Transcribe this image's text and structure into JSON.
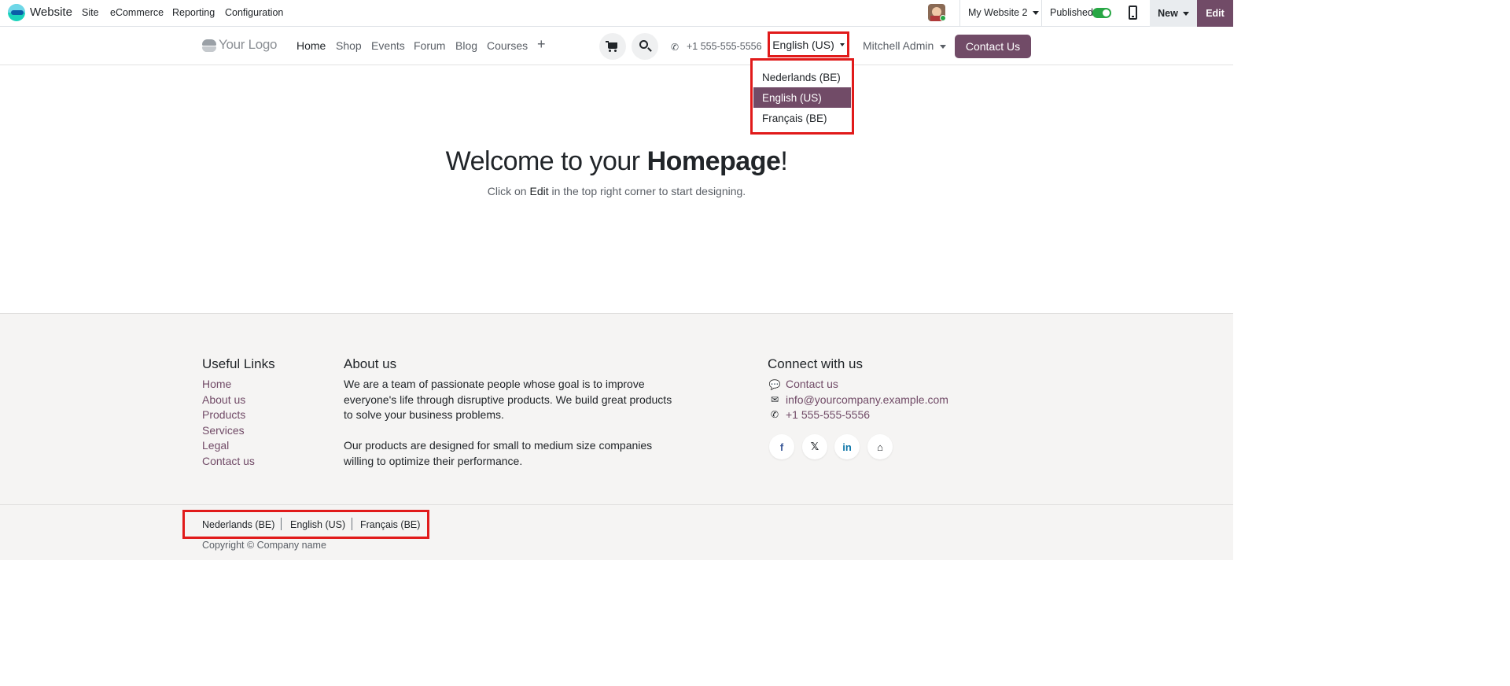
{
  "odoo_bar": {
    "app_name": "Website",
    "menu": [
      "Site",
      "eCommerce",
      "Reporting",
      "Configuration"
    ],
    "website_switcher": "My Website 2",
    "published_label": "Published",
    "published": true,
    "new_label": "New",
    "edit_label": "Edit"
  },
  "header": {
    "logo_text": "Your Logo",
    "nav": [
      "Home",
      "Shop",
      "Events",
      "Forum",
      "Blog",
      "Courses"
    ],
    "add_menu": "+",
    "phone": "+1 555-555-5556",
    "language": "English (US)",
    "user": "Mitchell Admin",
    "contact_button": "Contact Us"
  },
  "language_dropdown": {
    "items": [
      "Nederlands (BE)",
      "English (US)",
      "Français (BE)"
    ],
    "active": "English (US)"
  },
  "hero": {
    "title_prefix": "Welcome to your ",
    "title_bold": "Homepage",
    "title_suffix": "!",
    "sub_prefix": "Click on ",
    "sub_keyword": "Edit",
    "sub_suffix": " in the top right corner to start designing."
  },
  "footer": {
    "useful_links": {
      "title": "Useful Links",
      "items": [
        "Home",
        "About us",
        "Products",
        "Services",
        "Legal",
        "Contact us"
      ]
    },
    "about": {
      "title": "About us",
      "para1": "We are a team of passionate people whose goal is to improve everyone's life through disruptive products. We build great products to solve your business problems.",
      "para2": "Our products are designed for small to medium size companies willing to optimize their performance."
    },
    "connect": {
      "title": "Connect with us",
      "contact": "Contact us",
      "email": "info@yourcompany.example.com",
      "phone": "+1 555-555-5556"
    },
    "social": [
      "f",
      "𝕏",
      "in",
      "⌂"
    ],
    "languages": [
      "Nederlands (BE)",
      "English (US)",
      "Français (BE)"
    ],
    "copyright": "Copyright © Company name"
  },
  "colors": {
    "brand": "#714b67",
    "highlight": "#e11a1a",
    "toggle_on": "#28a745"
  }
}
